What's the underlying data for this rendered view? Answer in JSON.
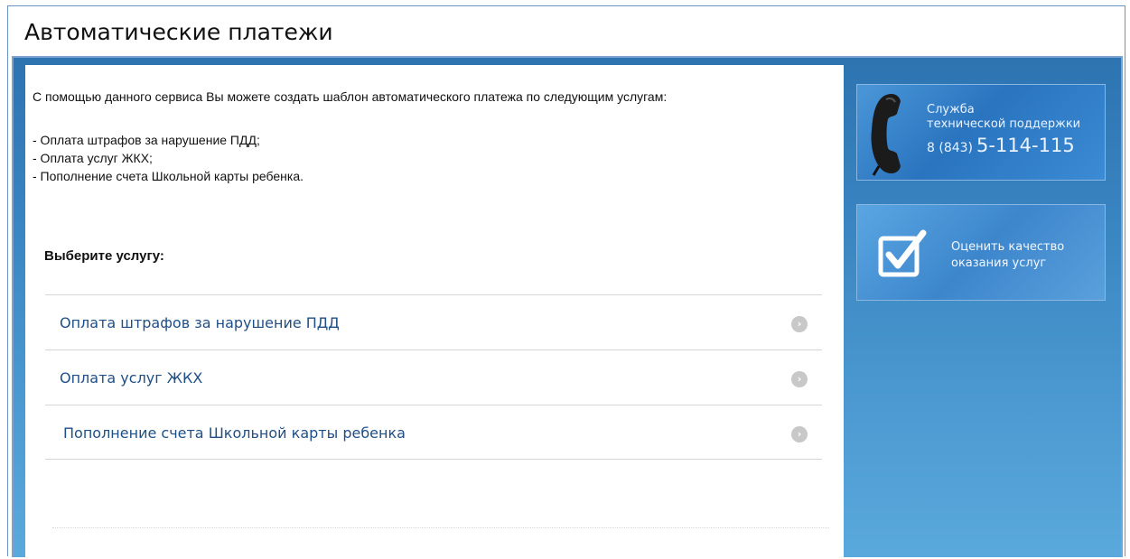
{
  "title": "Автоматические платежи",
  "intro": "С помощью данного сервиса Вы можете создать шаблон автоматического платежа по следующим услугам:",
  "bullets": [
    "- Оплата штрафов за нарушение ПДД;",
    "- Оплата услуг ЖКХ;",
    "- Пополнение счета Школьной карты ребенка."
  ],
  "choose_label": "Выберите услугу:",
  "services": [
    {
      "label": "Оплата штрафов за нарушение ПДД"
    },
    {
      "label": "Оплата услуг ЖКХ"
    },
    {
      "label": "Пополнение счета Школьной карты ребенка"
    }
  ],
  "support": {
    "line1": "Служба",
    "line2": "технической поддержки",
    "code": "8 (843)",
    "number": "5-114-115"
  },
  "rate": {
    "line1": "Оценить качество",
    "line2": "оказания услуг"
  },
  "icons": {
    "arrow": "chevron-right-circle",
    "phone": "telephone-handset",
    "check": "checkbox-checked"
  }
}
